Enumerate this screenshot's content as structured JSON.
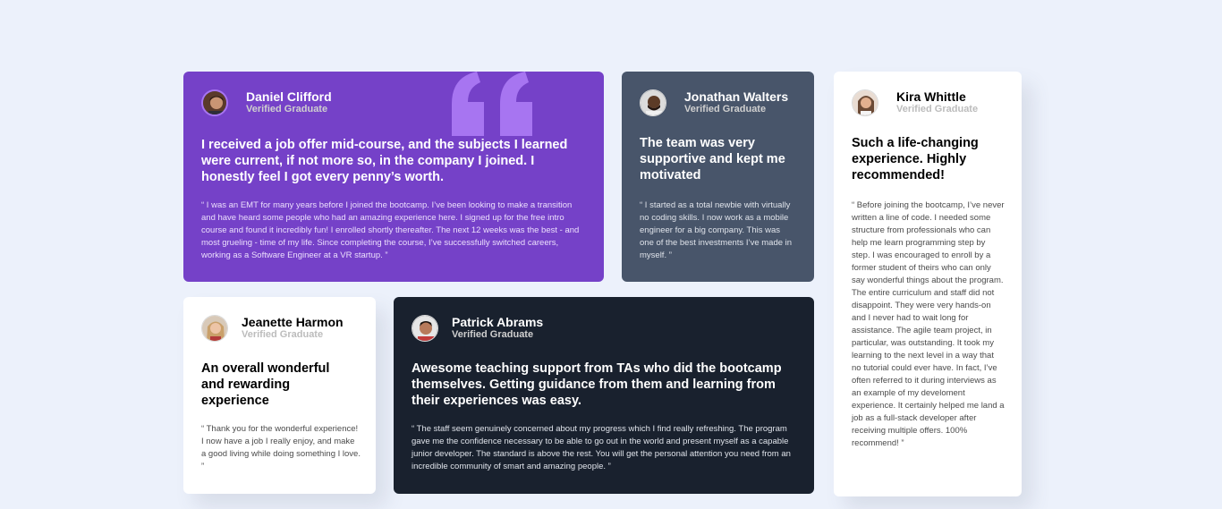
{
  "testimonials": {
    "daniel": {
      "name": "Daniel Clifford",
      "status": "Verified Graduate",
      "headline": "I received a job offer mid-course, and the subjects I learned were current, if not more so, in the company I joined. I honestly feel I got every penny’s worth.",
      "quote": "“ I was an EMT for many years before I joined the bootcamp. I’ve been looking to make a transition and have heard some people who had an amazing experience here. I signed up for the free intro course and found it incredibly fun! I enrolled shortly thereafter. The next 12 weeks was the best - and most grueling - time of my life. Since completing the course, I’ve successfully switched careers, working as a Software Engineer at a VR startup. ”"
    },
    "jonathan": {
      "name": "Jonathan Walters",
      "status": "Verified Graduate",
      "headline": "The team was very supportive and kept me motivated",
      "quote": "“ I started as a total newbie with virtually no coding skills. I now work as a mobile engineer for a big company. This was one of the best investments I’ve made in myself. ”"
    },
    "kira": {
      "name": "Kira Whittle",
      "status": "Verified Graduate",
      "headline": "Such a life-changing experience. Highly recommended!",
      "quote": "“ Before joining the bootcamp, I’ve never written a line of code. I needed some structure from professionals who can help me learn programming step by step. I was encouraged to enroll by a former student of theirs who can only say wonderful things about the program. The entire curriculum and staff did not disappoint. They were very hands-on and I never had to wait long for assistance. The agile team project, in particular, was outstanding. It took my learning to the next level in a way that no tutorial could ever have. In fact, I’ve often referred to it during interviews as an example of my develoment experience. It certainly helped me land a job as a full-stack developer after receiving multiple offers. 100% recommend! ”"
    },
    "jeanette": {
      "name": "Jeanette Harmon",
      "status": "Verified Graduate",
      "headline": "An overall wonderful and rewarding experience",
      "quote": "“ Thank you for the wonderful experience! I now have a job I really enjoy, and make a good living while doing something I love. ”"
    },
    "patrick": {
      "name": "Patrick Abrams",
      "status": "Verified Graduate",
      "headline": "Awesome teaching support from TAs who did the bootcamp themselves. Getting guidance from them and learning from their experiences was easy.",
      "quote": "“ The staff seem genuinely concerned about my progress which I find really refreshing. The program gave me the confidence necessary to be able to go out in the world and present myself as a capable junior developer. The standard is above the rest. You will get the personal attention you need from an incredible community of smart and amazing people. ”"
    }
  },
  "colors": {
    "page_background": "#ecf1fb",
    "purple": "#7541c8",
    "grey_blue": "#48556a",
    "dark_blue": "#19212e",
    "white": "#ffffff",
    "quote_mark": "#a775f1"
  },
  "icons": {
    "quote_mark": "quotation-mark-icon",
    "avatars": [
      "avatar-daniel",
      "avatar-jonathan",
      "avatar-kira",
      "avatar-jeanette",
      "avatar-patrick"
    ]
  }
}
